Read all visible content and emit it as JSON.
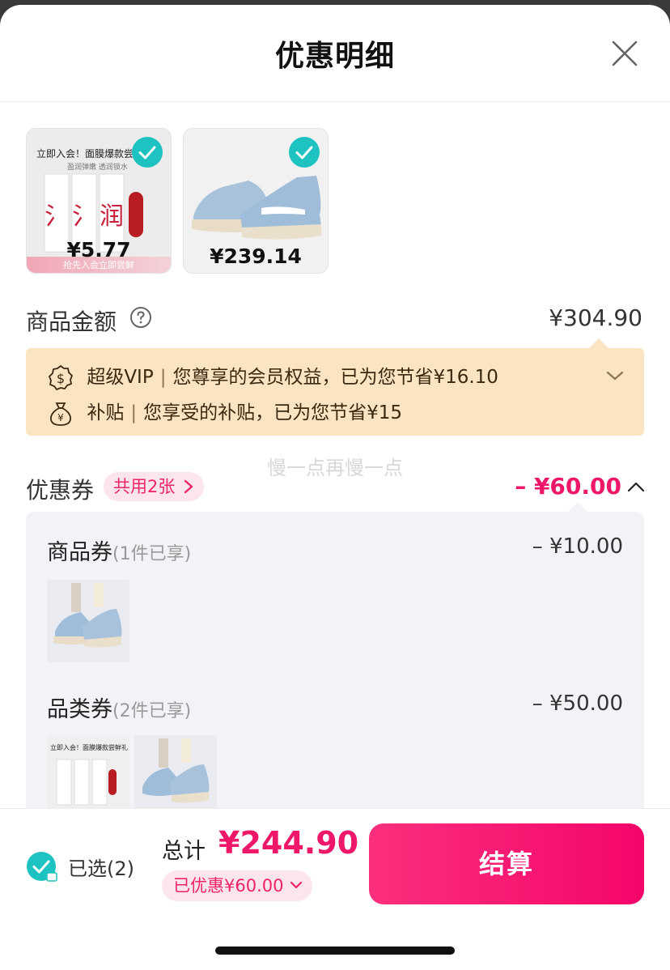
{
  "header": {
    "title": "优惠明细"
  },
  "products": [
    {
      "banner": "立即入会！面膜爆款尝鲜",
      "banner_sub": "盈润弹嫩 透润锁水",
      "price": "¥5.77",
      "bottom_text": "抢先入会立即尝鲜",
      "checked": true
    },
    {
      "price": "¥239.14",
      "checked": true
    }
  ],
  "amount_row": {
    "label": "商品金额",
    "value": "¥304.90"
  },
  "benefits": [
    {
      "icon": "dollar-badge-icon",
      "name": "超级VIP",
      "text": "您尊享的会员权益，已为您节省¥16.10"
    },
    {
      "icon": "money-bag-icon",
      "name": "补贴",
      "text": "您享受的补贴，已为您节省¥15"
    }
  ],
  "watermark": "慢一点再慢一点",
  "coupon_row": {
    "label": "优惠券",
    "tag": "共用2张",
    "value": "– ¥60.00"
  },
  "coupons": [
    {
      "title": "商品券",
      "sub": "(1件已享)",
      "value": "– ¥10.00"
    },
    {
      "title": "品类券",
      "sub": "(2件已享)",
      "value": "– ¥50.00",
      "mini_banner": "立即入会！面膜爆款尝鲜礼"
    }
  ],
  "footer": {
    "selected": "已选(2)",
    "total_label": "总计",
    "total_value": "¥244.90",
    "saved": "已优惠¥60.00",
    "checkout": "结算"
  },
  "colors": {
    "accent": "#ee1769",
    "teal": "#1ec2c0",
    "vip_bg": "#fbe4c2"
  }
}
